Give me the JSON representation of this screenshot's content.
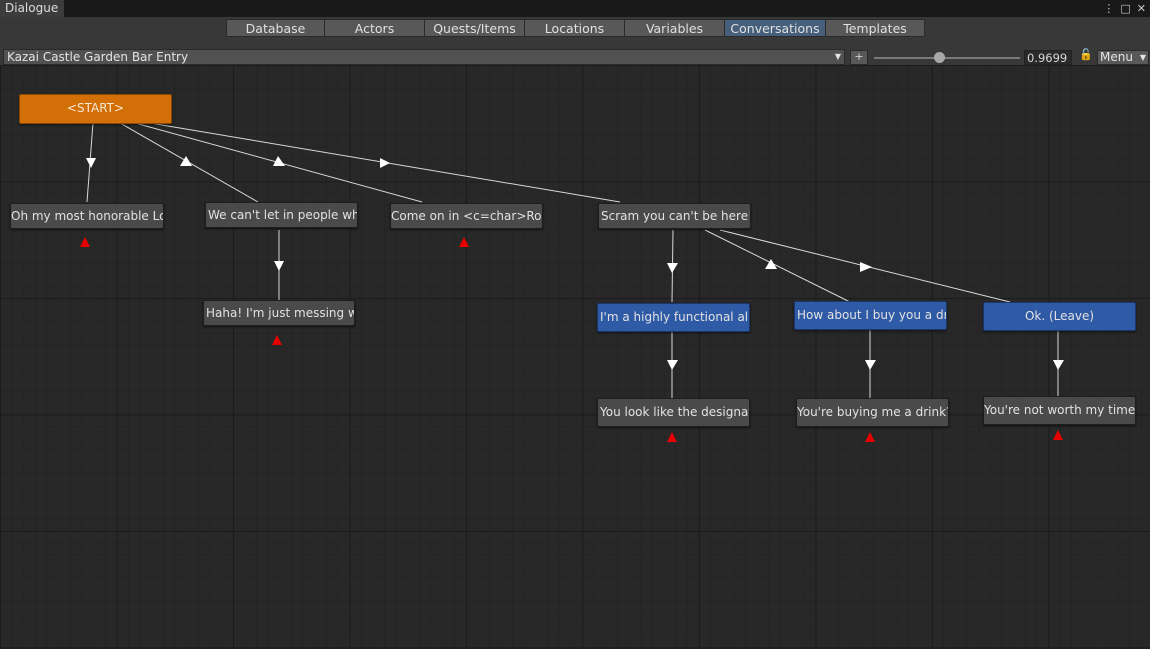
{
  "window": {
    "tab_title": "Dialogue",
    "icons": [
      "more-icon",
      "maximize-icon",
      "close-icon"
    ]
  },
  "toolbar": {
    "tabs": [
      {
        "label": "Database",
        "active": false
      },
      {
        "label": "Actors",
        "active": false
      },
      {
        "label": "Quests/Items",
        "active": false
      },
      {
        "label": "Locations",
        "active": false
      },
      {
        "label": "Variables",
        "active": false
      },
      {
        "label": "Conversations",
        "active": true
      },
      {
        "label": "Templates",
        "active": false
      }
    ],
    "conversation": "Kazai Castle Garden Bar Entry",
    "add_label": "+",
    "zoom_value": "0.9699",
    "zoom_fraction": 0.45,
    "menu_label": "Menu"
  },
  "colors": {
    "npc_node": "#4a4a4a",
    "pc_node": "#2f5aa6",
    "start_node": "#d26f06",
    "link": "#d8d8d8",
    "warning": "#e60000"
  },
  "nodes": {
    "start": "<START>",
    "n1": "Oh my most honorable Lord.",
    "n2": "We can't let in people who",
    "n3": "Come on in  <c=char>Ronin<",
    "n4": "Scram you can't be here! T",
    "n5": "Haha! I'm just messing wit",
    "n6": "I'm a highly functional al",
    "n7": "How about I buy you a drin",
    "n8": "Ok. (Leave)",
    "n9": "You look like the designat",
    "n10": "You're buying me a drink?",
    "n11": "You're not worth my time."
  }
}
